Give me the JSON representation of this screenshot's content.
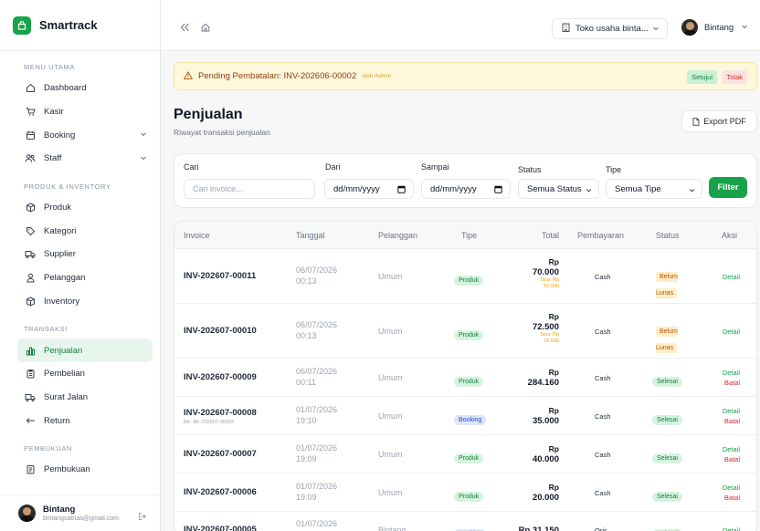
{
  "app": {
    "name": "Smartrack"
  },
  "sidebar": {
    "sections": [
      {
        "title": "MENU UTAMA",
        "items": [
          {
            "label": "Dashboard",
            "icon": "home-icon"
          },
          {
            "label": "Kasir",
            "icon": "cart-icon"
          },
          {
            "label": "Booking",
            "icon": "calendar-icon",
            "expandable": true
          },
          {
            "label": "Staff",
            "icon": "users-icon",
            "expandable": true
          }
        ]
      },
      {
        "title": "PRODUK & INVENTORY",
        "items": [
          {
            "label": "Produk",
            "icon": "box-icon"
          },
          {
            "label": "Kategori",
            "icon": "tag-icon"
          },
          {
            "label": "Supplier",
            "icon": "truck-icon"
          },
          {
            "label": "Pelanggan",
            "icon": "people-icon"
          },
          {
            "label": "Inventory",
            "icon": "box-icon"
          }
        ]
      },
      {
        "title": "TRANSAKSI",
        "items": [
          {
            "label": "Penjualan",
            "icon": "chart-icon",
            "active": true
          },
          {
            "label": "Pembelian",
            "icon": "clipboard-icon"
          },
          {
            "label": "Surat Jalan",
            "icon": "truck-icon"
          },
          {
            "label": "Return",
            "icon": "return-icon"
          }
        ]
      },
      {
        "title": "PEMBUKUAN",
        "items": [
          {
            "label": "Pembukuan",
            "icon": "ledger-icon"
          }
        ]
      }
    ],
    "user": {
      "name": "Bintang",
      "email": "bintangsatriaa@gmail.com"
    }
  },
  "topbar": {
    "store": "Toko usaha binta...",
    "user": "Bintang"
  },
  "banner": {
    "text": "Pending Pembatalan: INV-202606-00002",
    "by": "oleh Admin",
    "approve": "Setujui",
    "reject": "Tolak"
  },
  "page": {
    "title": "Penjualan",
    "subtitle": "Riwayat transaksi penjualan",
    "export": "Export PDF"
  },
  "filters": {
    "search_label": "Cari",
    "search_placeholder": "Cari invoice...",
    "from_label": "Dari",
    "from_value": "dd/mm/yyyy",
    "to_label": "Sampai",
    "to_value": "dd/mm/yyyy",
    "status_label": "Status",
    "status_value": "Semua Status",
    "type_label": "Tipe",
    "type_value": "Semua Tipe",
    "button": "Filter"
  },
  "table": {
    "columns": [
      "Invoice",
      "Tanggal",
      "Pelanggan",
      "Tipe",
      "Total",
      "Pembayaran",
      "Status",
      "Aksi"
    ],
    "rows": [
      {
        "invoice": "INV-202607-00011",
        "sub": "",
        "date": "06/07/2026",
        "time": "00:13",
        "customer": "Umum",
        "type": "Produk",
        "currency": "Rp",
        "total": "70.000",
        "due": "Sisa: Rp",
        "due_amount": "50.000",
        "payment": "Cash",
        "status": "Belum Lunas",
        "detail": "Detail",
        "cancel": ""
      },
      {
        "invoice": "INV-202607-00010",
        "sub": "",
        "date": "06/07/2026",
        "time": "00:13",
        "customer": "Umum",
        "type": "Produk",
        "currency": "Rp",
        "total": "72.500",
        "due": "Sisa: Rp",
        "due_amount": "22.500",
        "payment": "Cash",
        "status": "Belum Lunas",
        "detail": "Detail",
        "cancel": ""
      },
      {
        "invoice": "INV-202607-00009",
        "sub": "",
        "date": "06/07/2026",
        "time": "00:11",
        "customer": "Umum",
        "type": "Produk",
        "currency": "Rp",
        "total": "284.160",
        "due": "",
        "due_amount": "",
        "payment": "Cash",
        "status": "Selesai",
        "detail": "Detail",
        "cancel": "Batal"
      },
      {
        "invoice": "INV-202607-00008",
        "sub": "BK: BK-202607-00003",
        "date": "01/07/2026",
        "time": "19:10",
        "customer": "Umum",
        "type": "Booking",
        "currency": "Rp",
        "total": "35.000",
        "due": "",
        "due_amount": "",
        "payment": "Cash",
        "status": "Selesai",
        "detail": "Detail",
        "cancel": "Batal"
      },
      {
        "invoice": "INV-202607-00007",
        "sub": "",
        "date": "01/07/2026",
        "time": "19:09",
        "customer": "Umum",
        "type": "Produk",
        "currency": "Rp",
        "total": "40.000",
        "due": "",
        "due_amount": "",
        "payment": "Cash",
        "status": "Selesai",
        "detail": "Detail",
        "cancel": "Batal"
      },
      {
        "invoice": "INV-202607-00006",
        "sub": "",
        "date": "01/07/2026",
        "time": "19:09",
        "customer": "Umum",
        "type": "Produk",
        "currency": "Rp",
        "total": "20.000",
        "due": "",
        "due_amount": "",
        "payment": "Cash",
        "status": "Selesai",
        "detail": "Detail",
        "cancel": "Batal"
      },
      {
        "invoice": "INV-202607-00005",
        "sub": "",
        "date": "01/07/2026",
        "time": "",
        "customer": "Bintang",
        "type": "Booking",
        "currency": "",
        "total": "Rp 31.150",
        "due": "",
        "due_amount": "",
        "payment": "Qris",
        "status": "Selesai",
        "detail": "Detail",
        "cancel": ""
      }
    ]
  }
}
